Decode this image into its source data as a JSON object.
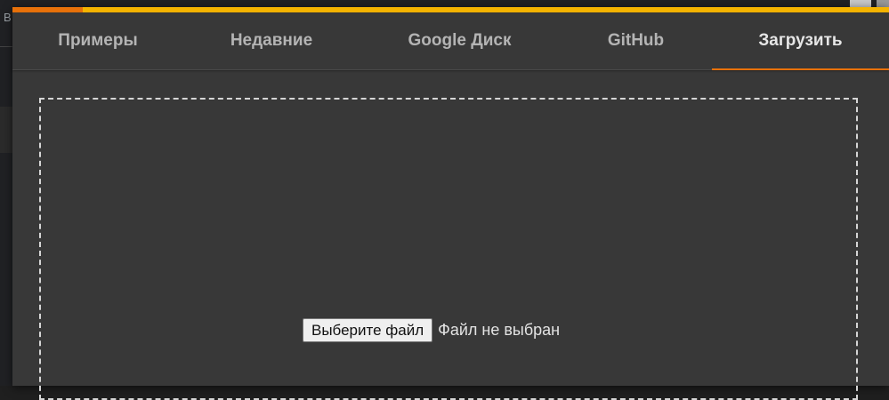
{
  "background": {
    "fragment_text": "В"
  },
  "dialog": {
    "progress": {
      "value_fraction": 0.08,
      "fill_color": "#e8710a",
      "track_color": "#f5b400"
    },
    "tabs": [
      {
        "label": "Примеры",
        "active": false
      },
      {
        "label": "Недавние",
        "active": false
      },
      {
        "label": "Google Диск",
        "active": false
      },
      {
        "label": "GitHub",
        "active": false
      },
      {
        "label": "Загрузить",
        "active": true
      }
    ],
    "upload": {
      "choose_button_label": "Выберите файл",
      "status_text": "Файл не выбран"
    }
  },
  "colors": {
    "accent": "#e8710a",
    "dialog_bg": "#383838"
  }
}
